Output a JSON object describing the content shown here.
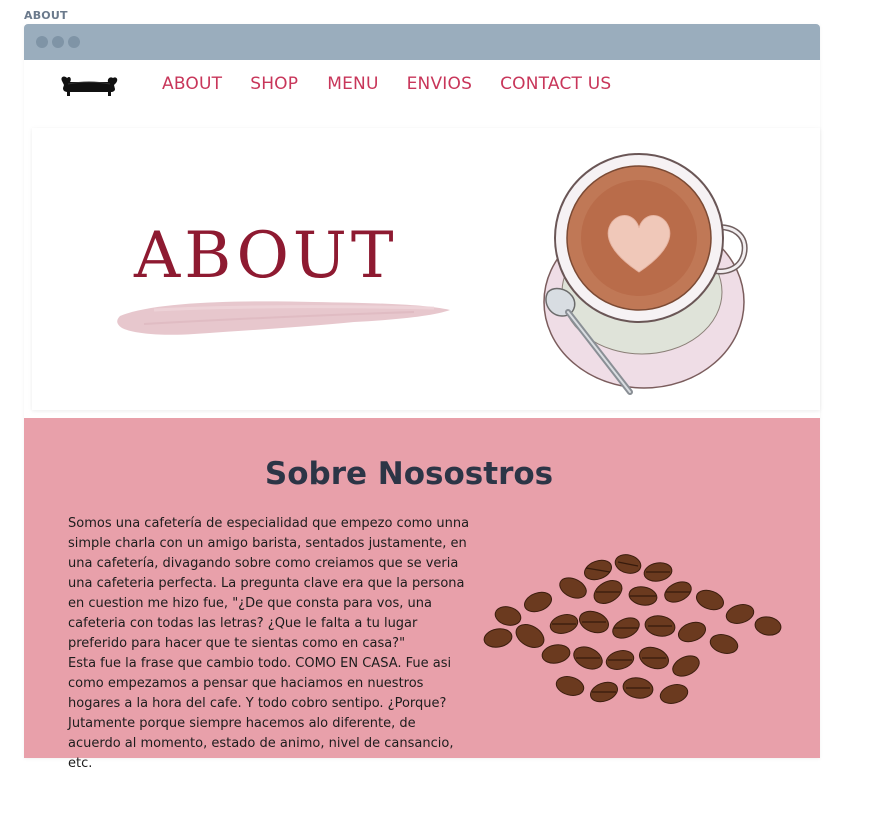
{
  "page_label": "ABOUT",
  "nav": {
    "logo_icon": "sofa-icon",
    "items": [
      "ABOUT",
      "SHOP",
      "MENU",
      "ENVIOS",
      "CONTACT US"
    ]
  },
  "hero": {
    "title": "ABOUT",
    "image_icon": "coffee-cup-latte-art-icon"
  },
  "about": {
    "heading": "Sobre Nosostros",
    "body": "Somos una cafetería de especialidad que empezo como unna simple charla con un amigo barista, sentados justamente, en una cafetería, divagando sobre como creiamos que se veria una cafeteria perfecta. La pregunta clave era que la persona en cuestion me hizo fue, \"¿De que consta para vos, una cafeteria con todas las letras? ¿Que le falta a tu lugar preferido para hacer que te sientas como en casa?\"\nEsta fue la frase que cambio todo. COMO EN CASA. Fue asi como empezamos a pensar que haciamos en nuestros hogares a la hora del cafe. Y todo cobro sentipo. ¿Porque? Jutamente porque siempre hacemos alo diferente, de acuerdo al momento, estado de animo, nivel de cansancio, etc.",
    "image_icon": "coffee-beans-icon"
  },
  "colors": {
    "nav_text": "#c8365a",
    "titlebar": "#9aadbd",
    "about_bg": "#e8a0aa",
    "heading": "#2c3546",
    "hero_title": "#8e1a31"
  }
}
